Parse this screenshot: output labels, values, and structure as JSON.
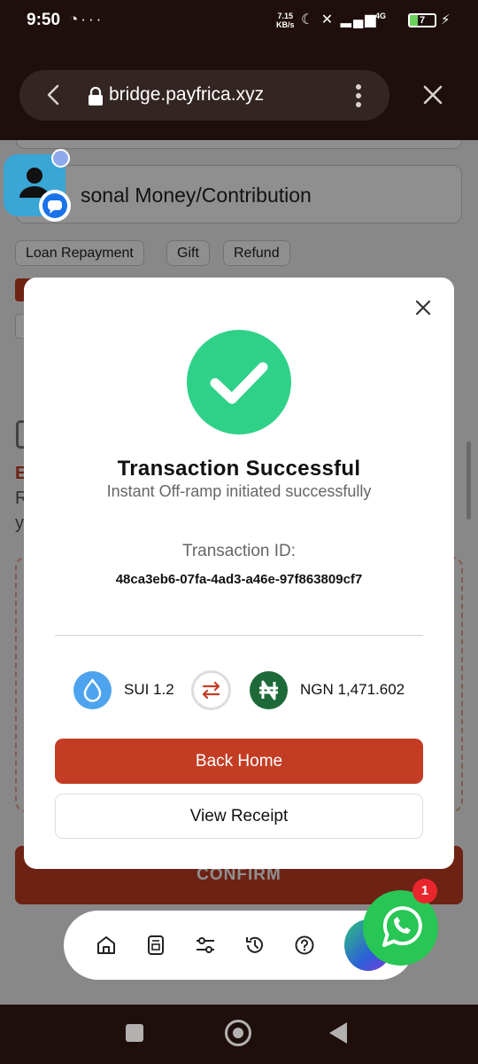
{
  "status_bar": {
    "time": "9:50",
    "left_icons": [
      "whatsapp-status-icon",
      "more-dots-icon"
    ],
    "net_speed_value": "7.15",
    "net_speed_unit": "KB/s",
    "network_type": "4G",
    "battery_level": "7",
    "right_icons": [
      "moon-icon",
      "silent-icon",
      "signal-icon",
      "signal-icon",
      "battery-icon",
      "charging-icon"
    ]
  },
  "browser": {
    "url": "bridge.payfrica.xyz"
  },
  "page": {
    "purpose_value": "sonal Money/Contribution",
    "chips": [
      "Loan Repayment",
      "Gift",
      "Refund"
    ],
    "partial_red_letter": "E",
    "partial_letter_1": "R",
    "partial_letter_2": "y",
    "confirm_label": "CONFIRM"
  },
  "modal": {
    "title": "Transaction Successful",
    "subtitle": "Instant Off-ramp initiated successfully",
    "txid_label": "Transaction ID:",
    "txid": "48ca3eb6-07fa-4ad3-a46e-97f863809cf7",
    "from_amount": "SUI 1.2",
    "to_amount": "NGN 1,471.602",
    "back_home_label": "Back Home",
    "view_receipt_label": "View Receipt"
  },
  "bottom_nav": {
    "items": [
      "home-icon",
      "receipt-icon",
      "sliders-icon",
      "history-icon",
      "help-icon"
    ]
  },
  "whatsapp": {
    "badge_count": "1"
  },
  "colors": {
    "accent": "#c33d24",
    "success": "#2fd189",
    "sui_blue": "#4ea3ee",
    "naira_green": "#1d6a38",
    "whatsapp_green": "#28c654",
    "chrome_dark": "#1e0f0c"
  }
}
